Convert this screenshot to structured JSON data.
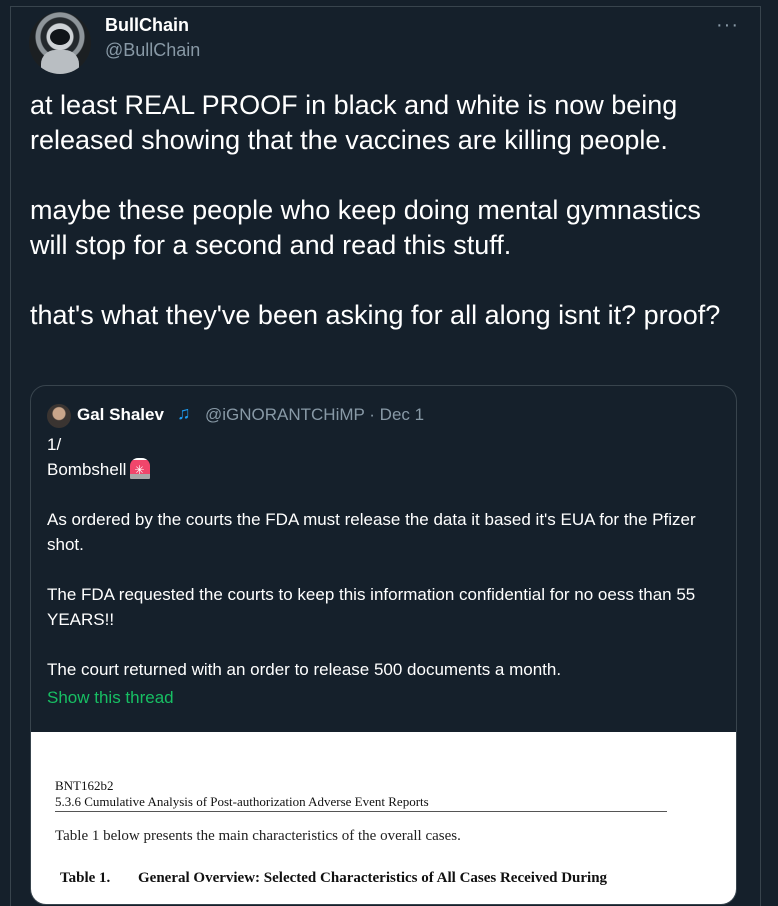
{
  "author": {
    "name": "BullChain",
    "handle": "@BullChain",
    "avatar_icon": "astronaut-avatar"
  },
  "more_label": "···",
  "tweet": {
    "text": "at least REAL PROOF in black and white is now being released showing that the vaccines are killing people.\n\nmaybe these people who keep doing mental gymnastics will stop for a second and read this stuff.\n\nthat's what they've been asking for all along isnt it? proof?"
  },
  "quote": {
    "name": "Gal Shalev",
    "music_icon": "music-note-icon",
    "meta": "@iGNORANTCHiMP · Dec 1",
    "line1": "1/",
    "line2": "Bombshell",
    "siren_icon": "siren-emoji-icon",
    "body": "As ordered by the courts the FDA must release the data it based it's EUA for the Pfizer shot.\n\nThe FDA requested the courts to keep this information confidential for no oess than 55 YEARS!!\n\nThe court returned with an order to release 500 documents a month.",
    "show_thread": "Show this thread",
    "image": {
      "code": "BNT162b2",
      "subtitle": "5.3.6 Cumulative Analysis of Post-authorization Adverse Event Reports",
      "paragraph": "Table 1 below presents the main characteristics of the overall cases.",
      "table_no": "Table 1.",
      "table_title": "General Overview: Selected Characteristics of All Cases Received During"
    }
  },
  "colors": {
    "background": "#15202b",
    "secondary_text": "#8899a6",
    "border": "#38444d",
    "link_green": "#17bf63"
  }
}
